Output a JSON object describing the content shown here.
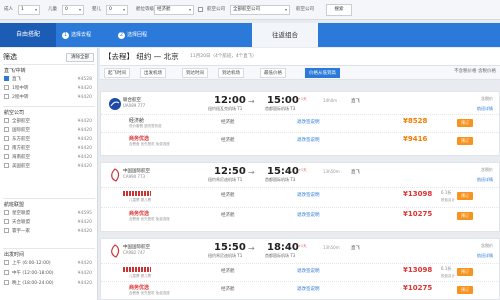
{
  "topbar": {
    "adult_label": "成人",
    "adult_value": "1",
    "child_label": "儿童",
    "child_value": "0",
    "infant_label": "婴儿",
    "infant_value": "0",
    "cabin_label": "舱位等级",
    "cabin_value": "经济舱",
    "airline_label": "航空公司",
    "airline_value": "全部航空公司",
    "search_label": "搜索"
  },
  "band": {
    "tab_free": "自由搭配",
    "step1": "选择去程",
    "step2": "选择回程",
    "tab_combo": "往返组合"
  },
  "sidebar": {
    "title": "筛选",
    "reset_label": "清除全部",
    "sections": [
      {
        "title": "直飞/中转",
        "items": [
          {
            "label": "直飞",
            "price": "¥4528",
            "checked": true
          },
          {
            "label": "1程中转",
            "price": "¥4420",
            "checked": false
          },
          {
            "label": "2程中转",
            "price": "¥4420",
            "checked": false
          }
        ]
      },
      {
        "title": "航空公司",
        "items": [
          {
            "label": "全部航空",
            "price": "¥4420",
            "checked": false
          },
          {
            "label": "国际航空",
            "price": "¥4420",
            "checked": false
          },
          {
            "label": "东方航空",
            "price": "¥4420",
            "checked": false
          },
          {
            "label": "南方航空",
            "price": "¥4420",
            "checked": false
          },
          {
            "label": "海南航空",
            "price": "¥4420",
            "checked": false
          },
          {
            "label": "美国航空",
            "price": "¥4420",
            "checked": false
          }
        ]
      },
      {
        "title": "航班联盟",
        "items": [
          {
            "label": "星空联盟",
            "price": "¥4595",
            "checked": false
          },
          {
            "label": "天合联盟",
            "price": "¥4420",
            "checked": false
          },
          {
            "label": "寰宇一家",
            "price": "¥4420",
            "checked": false
          }
        ]
      },
      {
        "title": "出发时间",
        "items": [
          {
            "label": "上午 (6:00-12:00)",
            "price": "¥4420",
            "checked": false
          },
          {
            "label": "中午 (12:00-18:00)",
            "price": "¥4420",
            "checked": false
          },
          {
            "label": "晚上 (18:00-24:00)",
            "price": "¥4420",
            "checked": false
          }
        ]
      }
    ]
  },
  "route": {
    "title": "【去程】 纽约 — 北京",
    "meta": "11月20日（4个航班，4个直飞）"
  },
  "sort": {
    "dep_time": "起飞时间",
    "arr_time": "出发机场",
    "arr_airport": "到达时间",
    "duration": "到达机场",
    "price": "最低价格",
    "low_price": "价格从低到高",
    "right_text": "不含税价格  含税价格"
  },
  "flights": [
    {
      "airline": "联合航空",
      "number": "UA089 777",
      "dep": "12:00",
      "arr": "15:00",
      "plus": "+1天",
      "dep_airport": "纽约纽瓦克机场 T1",
      "arr_airport": "首都国际机场 T3",
      "duration": "14h0m",
      "plane": "直飞",
      "tag": "含税价",
      "unfold": "航班详情",
      "fares": [
        {
          "name": "经济舱",
          "sub": "低价套餐 退改签收费",
          "type": "经济舱",
          "rule": "退改签说明",
          "price": "¥8528",
          "note": "",
          "dcnt": "",
          "red": false,
          "badge": "预订"
        },
        {
          "name": "商务优选",
          "sub": "含餐食 优先登机 免费选座",
          "type": "经济舱",
          "rule": "退改签说明",
          "price": "¥9416",
          "note": "",
          "dcnt": "",
          "red": true,
          "badge": "预订"
        }
      ]
    },
    {
      "airline": "中国国际航空",
      "number": "CA990 773",
      "dep": "12:50",
      "arr": "15:40",
      "plus": "+1天",
      "dep_airport": "纽约肯尼迪机场 T1",
      "arr_airport": "首都国际机场 T3",
      "duration": "13h50m",
      "plane": "直飞",
      "tag": "含税价",
      "unfold": "航班详情",
      "fares": [
        {
          "name": "经济舱",
          "sub": "儿童票 婴儿票",
          "type": "经济舱",
          "rule": "退改签说明",
          "price": "¥13098",
          "note": "税费另计",
          "dcnt": "6.1折",
          "red": true,
          "badge": "预订"
        },
        {
          "name": "商务优选",
          "sub": "含餐食 优先登机 免费选座",
          "type": "经济舱",
          "rule": "退改签说明",
          "price": "¥10275",
          "note": "",
          "dcnt": "",
          "red": true,
          "badge": "预订"
        }
      ]
    },
    {
      "airline": "中国国际航空",
      "number": "CA982 747",
      "dep": "15:50",
      "arr": "18:40",
      "plus": "+1天",
      "dep_airport": "纽约肯尼迪机场 T1",
      "arr_airport": "首都国际机场 T3",
      "duration": "13h50m",
      "plane": "直飞",
      "tag": "含税价",
      "unfold": "航班详情",
      "fares": [
        {
          "name": "经济舱",
          "sub": "儿童票 婴儿票",
          "type": "经济舱",
          "rule": "退改签说明",
          "price": "¥13098",
          "note": "税费另计",
          "dcnt": "6.1折",
          "red": true,
          "badge": "预订"
        },
        {
          "name": "商务优选",
          "sub": "含餐食 优先登机 免费选座",
          "type": "经济舱",
          "rule": "退改签说明",
          "price": "¥10275",
          "note": "",
          "dcnt": "",
          "red": true,
          "badge": "预订"
        }
      ]
    }
  ],
  "colors": {
    "brand_blue": "#2b79d8",
    "price_orange": "#f47b00",
    "price_red": "#d33333"
  }
}
